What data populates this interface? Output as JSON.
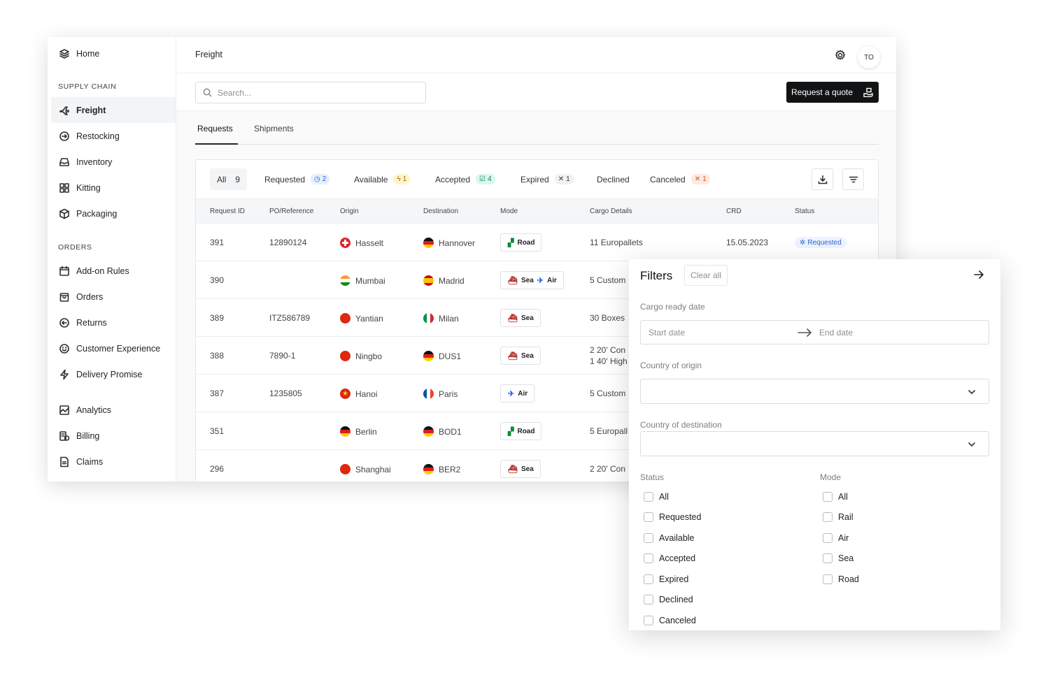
{
  "sidebar": {
    "home": "Home",
    "supply_chain_label": "SUPPLY CHAIN",
    "supply_chain": [
      "Freight",
      "Restocking",
      "Inventory",
      "Kitting",
      "Packaging"
    ],
    "orders_label": "ORDERS",
    "orders": [
      "Add-on Rules",
      "Orders",
      "Returns",
      "Customer Experience",
      "Delivery Promise"
    ],
    "other": [
      "Analytics",
      "Billing",
      "Claims"
    ]
  },
  "header": {
    "title": "Freight",
    "avatar_initials": "TO"
  },
  "search": {
    "placeholder": "Search...",
    "value": ""
  },
  "actions": {
    "request_quote": "Request a quote"
  },
  "tabs": [
    "Requests",
    "Shipments"
  ],
  "filter_chips": [
    {
      "label": "All",
      "count": "9"
    },
    {
      "label": "Requested",
      "count": "2"
    },
    {
      "label": "Available",
      "count": "1"
    },
    {
      "label": "Accepted",
      "count": "4"
    },
    {
      "label": "Expired",
      "count": "1"
    },
    {
      "label": "Declined",
      "count": ""
    },
    {
      "label": "Canceled",
      "count": "1"
    }
  ],
  "table": {
    "columns": [
      "Request ID",
      "PO/Reference",
      "Origin",
      "Destination",
      "Mode",
      "Cargo Details",
      "CRD",
      "Status"
    ],
    "rows": [
      {
        "id": "391",
        "ref": "12890124",
        "origin": "Hasselt",
        "destination": "Hannover",
        "mode": [
          "Road"
        ],
        "cargo": [
          "11 Europallets"
        ],
        "crd": "15.05.2023",
        "status": "Requested"
      },
      {
        "id": "390",
        "ref": "",
        "origin": "Mumbai",
        "destination": "Madrid",
        "mode": [
          "Sea",
          "Air"
        ],
        "cargo": [
          "5 Custom"
        ],
        "crd": "",
        "status": ""
      },
      {
        "id": "389",
        "ref": "ITZ586789",
        "origin": "Yantian",
        "destination": "Milan",
        "mode": [
          "Sea"
        ],
        "cargo": [
          "30 Boxes"
        ],
        "crd": "",
        "status": ""
      },
      {
        "id": "388",
        "ref": "7890-1",
        "origin": "Ningbo",
        "destination": "DUS1",
        "mode": [
          "Sea"
        ],
        "cargo": [
          "2 20' Con",
          "1 40' High"
        ],
        "crd": "",
        "status": ""
      },
      {
        "id": "387",
        "ref": "1235805",
        "origin": "Hanoi",
        "destination": "Paris",
        "mode": [
          "Air"
        ],
        "cargo": [
          "5 Custom"
        ],
        "crd": "",
        "status": ""
      },
      {
        "id": "351",
        "ref": "",
        "origin": "Berlin",
        "destination": "BOD1",
        "mode": [
          "Road"
        ],
        "cargo": [
          "5 Europall"
        ],
        "crd": "",
        "status": ""
      },
      {
        "id": "296",
        "ref": "",
        "origin": "Shanghai",
        "destination": "BER2",
        "mode": [
          "Sea"
        ],
        "cargo": [
          "2 20' Con"
        ],
        "crd": "",
        "status": ""
      }
    ]
  },
  "filters": {
    "title": "Filters",
    "clear_all": "Clear all",
    "cargo_ready_date": "Cargo ready date",
    "start_date_placeholder": "Start date",
    "end_date_placeholder": "End date",
    "country_of_origin": "Country of origin",
    "country_of_destination": "Country of destination",
    "status_label": "Status",
    "status_options": [
      "All",
      "Requested",
      "Available",
      "Accepted",
      "Expired",
      "Declined",
      "Canceled"
    ],
    "mode_label": "Mode",
    "mode_options": [
      "All",
      "Rail",
      "Air",
      "Sea",
      "Road"
    ]
  },
  "colors": {
    "primary_button": "#111315",
    "requested_blue": "#2563eb",
    "accepted_green": "#0f8a5f",
    "canceled_red": "#d9481c"
  }
}
